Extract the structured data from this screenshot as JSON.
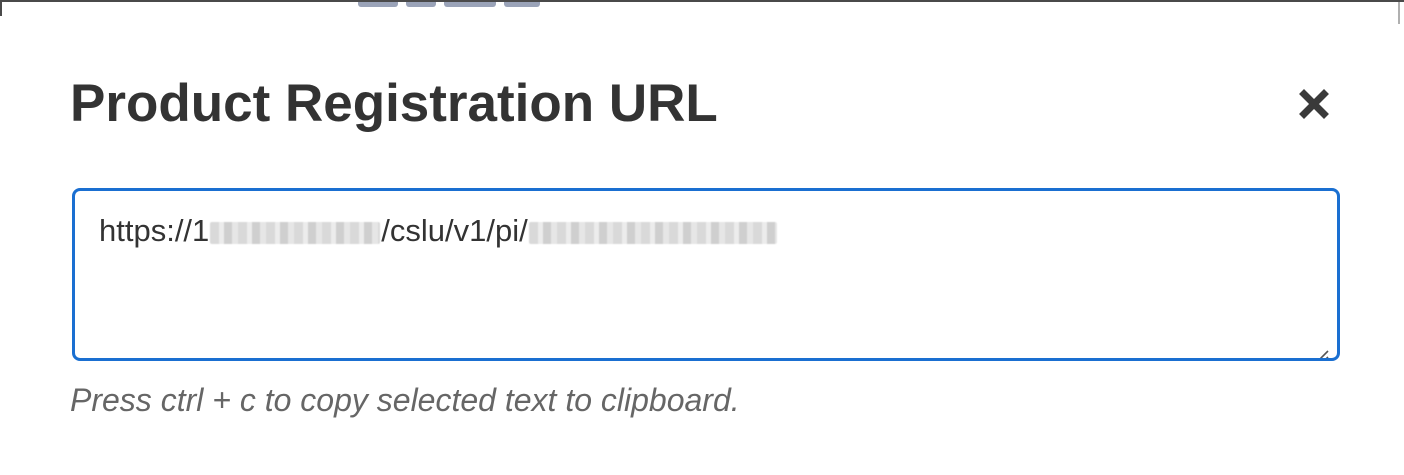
{
  "modal": {
    "title": "Product Registration URL",
    "close_icon": "close-icon",
    "textarea": {
      "url_prefix": "https://1",
      "url_middle": "/cslu/v1/pi/",
      "redacted": true,
      "resize_icon": "resize-grip-icon"
    },
    "help_text": "Press ctrl + c to copy selected text to clipboard."
  },
  "colors": {
    "title": "#333333",
    "focus_border": "#1a6fd1",
    "help_text": "#666666"
  }
}
